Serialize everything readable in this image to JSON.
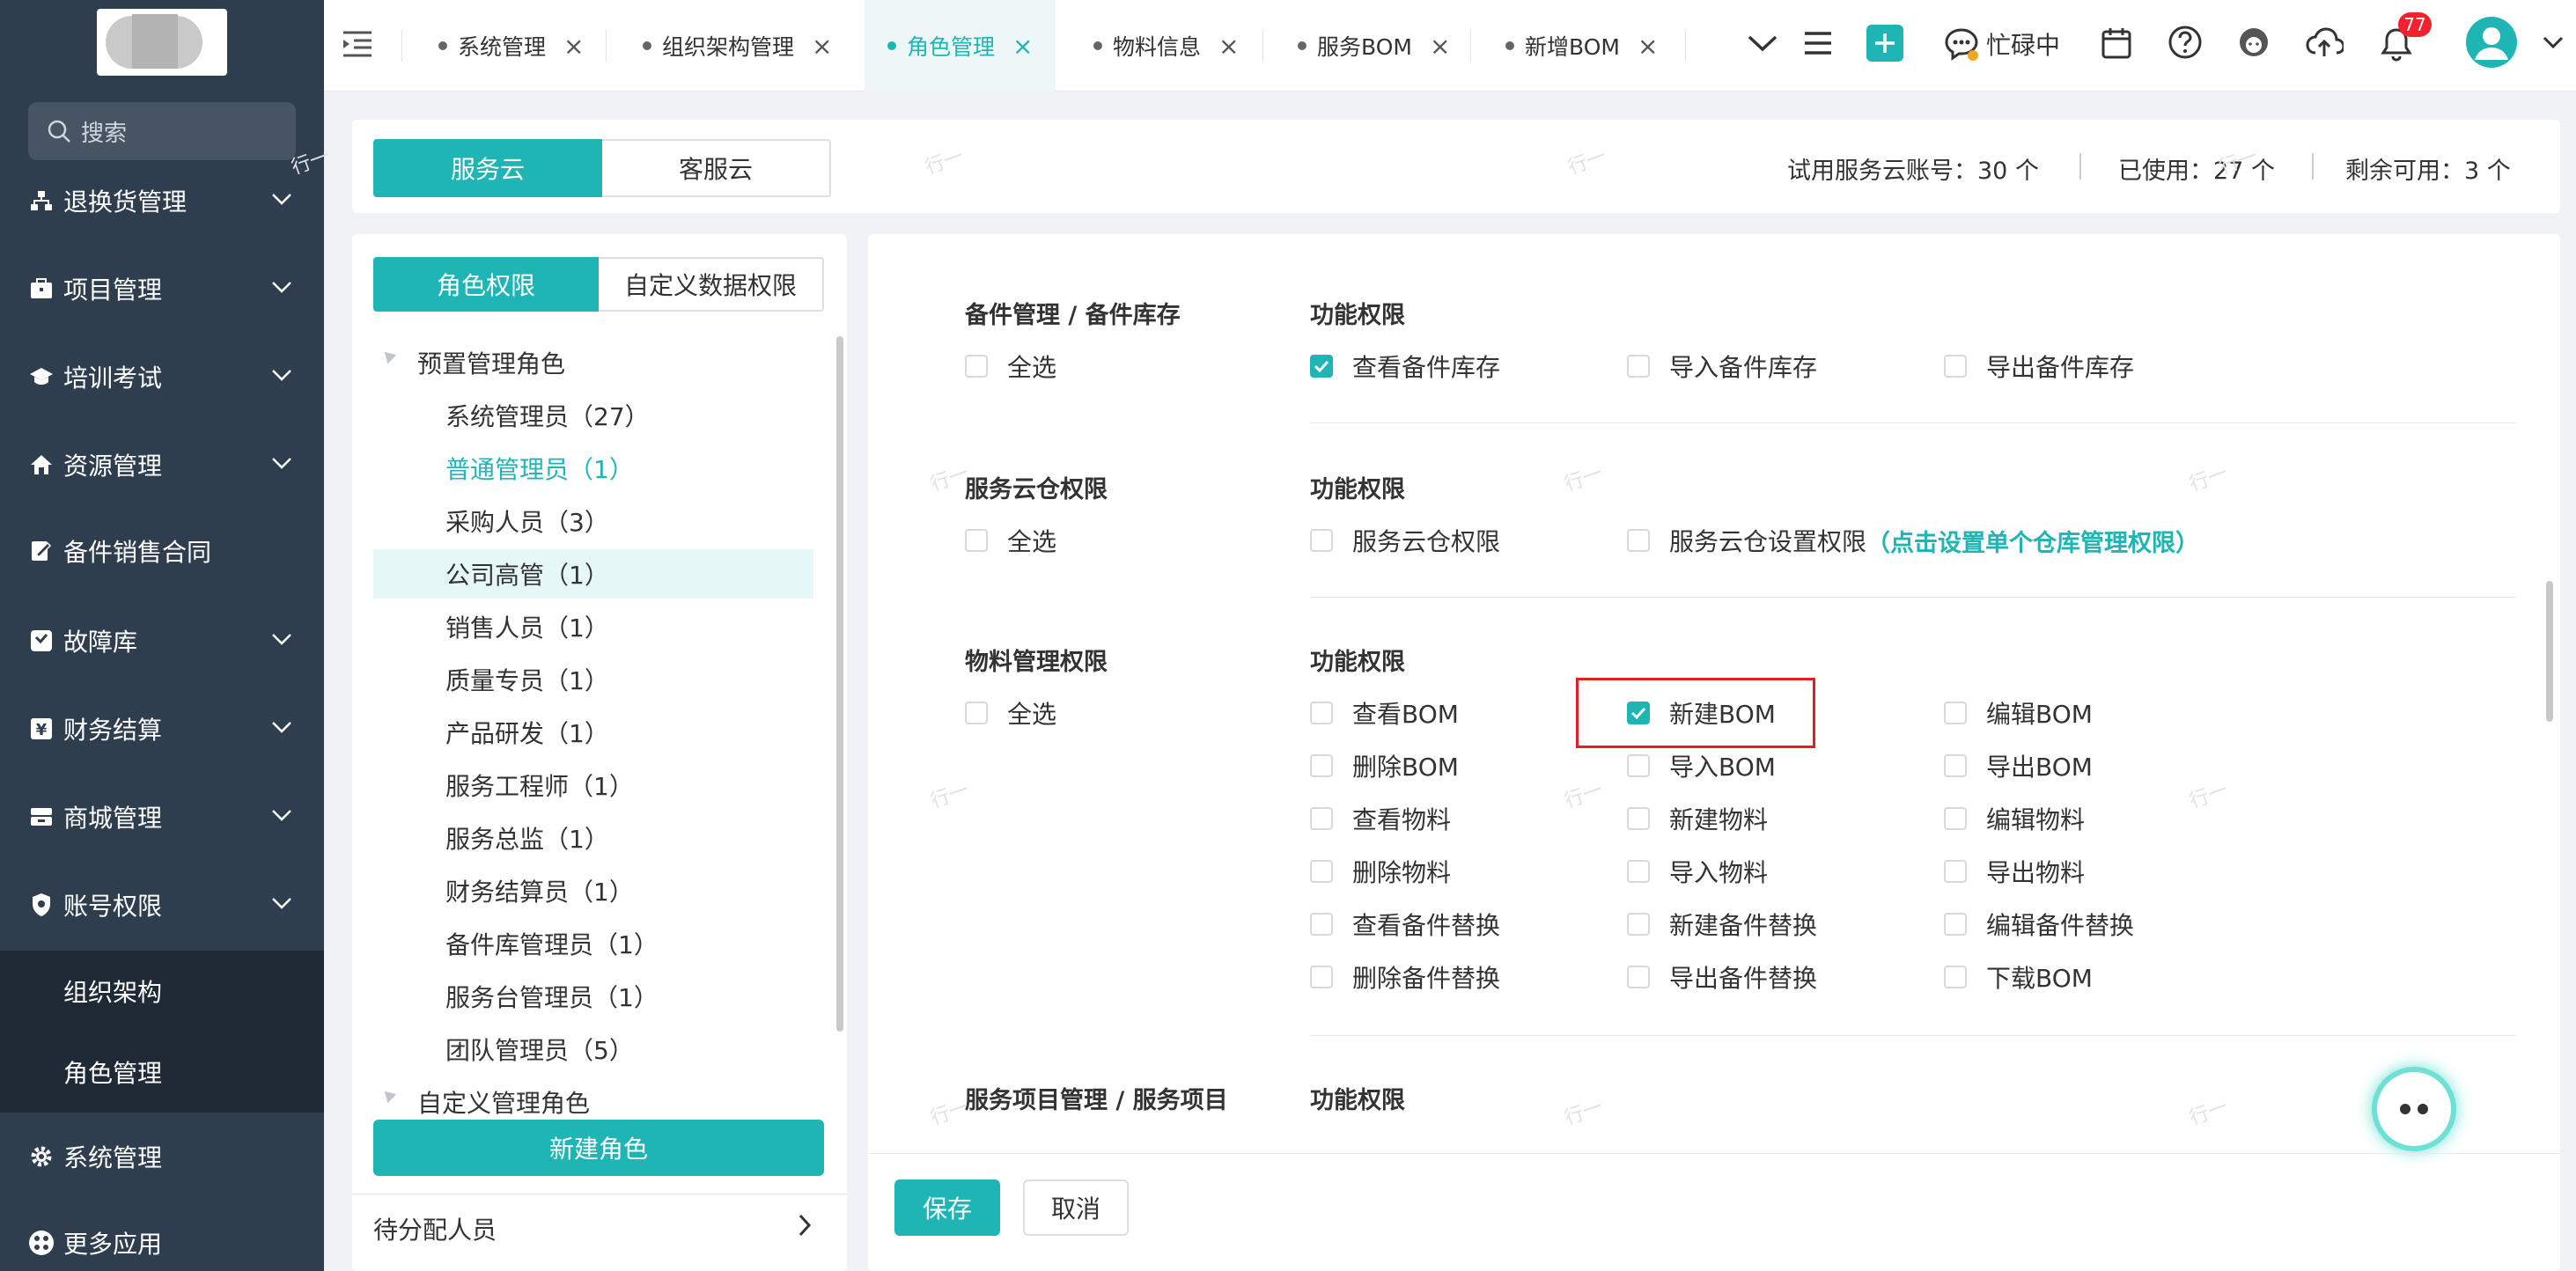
{
  "sidebar": {
    "search_placeholder": "搜索",
    "items": [
      {
        "label": "退换货管理",
        "icon": "sitemap-icon"
      },
      {
        "label": "项目管理",
        "icon": "briefcase-icon"
      },
      {
        "label": "培训考试",
        "icon": "graduation-cap-icon"
      },
      {
        "label": "资源管理",
        "icon": "home-icon"
      },
      {
        "label": "备件销售合同",
        "icon": "edit-document-icon"
      },
      {
        "label": "故障库",
        "icon": "fault-library-icon"
      },
      {
        "label": "财务结算",
        "icon": "yen-icon"
      },
      {
        "label": "商城管理",
        "icon": "store-icon"
      },
      {
        "label": "账号权限",
        "icon": "shield-icon"
      }
    ],
    "subitems": [
      {
        "label": "组织架构"
      },
      {
        "label": "角色管理"
      }
    ],
    "bottom_items": [
      {
        "label": "系统管理",
        "icon": "gear-icon"
      },
      {
        "label": "更多应用",
        "icon": "apps-icon"
      }
    ]
  },
  "tabs": [
    {
      "label": "系统管理",
      "active": false
    },
    {
      "label": "组织架构管理",
      "active": false
    },
    {
      "label": "角色管理",
      "active": true
    },
    {
      "label": "物料信息",
      "active": false
    },
    {
      "label": "服务BOM",
      "active": false
    },
    {
      "label": "新增BOM",
      "active": false
    }
  ],
  "header": {
    "status_label": "忙碌中",
    "notification_count": "77"
  },
  "quota": {
    "seg_service": "服务云",
    "seg_customer": "客服云",
    "trial_label": "试用服务云账号：",
    "trial_value": "30 个",
    "used_label": "已使用：",
    "used_value": "27 个",
    "remain_label": "剩余可用：",
    "remain_value": "3 个"
  },
  "left": {
    "tab_role": "角色权限",
    "tab_custom": "自定义数据权限",
    "group1": "预置管理角色",
    "roles": [
      "系统管理员（27）",
      "普通管理员（1）",
      "采购人员（3）",
      "公司高管（1）",
      "销售人员（1）",
      "质量专员（1）",
      "产品研发（1）",
      "服务工程师（1）",
      "服务总监（1）",
      "财务结算员（1）",
      "备件库管理员（1）",
      "服务台管理员（1）",
      "团队管理员（5）"
    ],
    "group2": "自定义管理角色",
    "new_role_button": "新建角色",
    "pending_label": "待分配人员"
  },
  "permissions": {
    "func_label": "功能权限",
    "select_all": "全选",
    "sections": [
      {
        "title": "备件管理 / 备件库存",
        "items": [
          {
            "label": "查看备件库存",
            "checked": true
          },
          {
            "label": "导入备件库存",
            "checked": false
          },
          {
            "label": "导出备件库存",
            "checked": false
          }
        ]
      },
      {
        "title": "服务云仓权限",
        "items": [
          {
            "label": "服务云仓权限",
            "checked": false
          },
          {
            "label": "服务云仓设置权限",
            "checked": false
          }
        ],
        "link": "（点击设置单个仓库管理权限）"
      },
      {
        "title": "物料管理权限",
        "items": [
          {
            "label": "查看BOM",
            "checked": false
          },
          {
            "label": "新建BOM",
            "checked": true
          },
          {
            "label": "编辑BOM",
            "checked": false
          },
          {
            "label": "删除BOM",
            "checked": false
          },
          {
            "label": "导入BOM",
            "checked": false
          },
          {
            "label": "导出BOM",
            "checked": false
          },
          {
            "label": "查看物料",
            "checked": false
          },
          {
            "label": "新建物料",
            "checked": false
          },
          {
            "label": "编辑物料",
            "checked": false
          },
          {
            "label": "删除物料",
            "checked": false
          },
          {
            "label": "导入物料",
            "checked": false
          },
          {
            "label": "导出物料",
            "checked": false
          },
          {
            "label": "查看备件替换",
            "checked": false
          },
          {
            "label": "新建备件替换",
            "checked": false
          },
          {
            "label": "编辑备件替换",
            "checked": false
          },
          {
            "label": "删除备件替换",
            "checked": false
          },
          {
            "label": "导出备件替换",
            "checked": false
          },
          {
            "label": "下载BOM",
            "checked": false
          }
        ]
      },
      {
        "title": "服务项目管理 / 服务项目",
        "items": []
      }
    ]
  },
  "footer": {
    "save": "保存",
    "cancel": "取消"
  },
  "watermark": "行一",
  "colors": {
    "accent": "#1fb5b5",
    "sidebar_bg": "#2f3e4f",
    "highlight_border": "#e02020",
    "badge": "#f5222d"
  }
}
